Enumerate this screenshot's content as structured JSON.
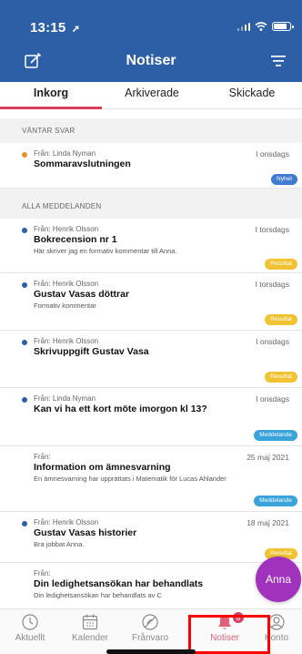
{
  "status": {
    "time": "13:15",
    "location_glyph": "➚"
  },
  "header": {
    "title": "Notiser",
    "color": "#2d5fa6"
  },
  "tabs": [
    {
      "label": "Inkorg",
      "active": true
    },
    {
      "label": "Arkiverade",
      "active": false
    },
    {
      "label": "Skickade",
      "active": false
    }
  ],
  "sections": {
    "waiting": "VÄNTAR SVAR",
    "all": "ALLA MEDDELANDEN"
  },
  "messages": [
    {
      "from": "Från: Linda Nyman",
      "date": "I onsdags",
      "title": "Sommaravslutningen",
      "preview": "",
      "badge": "Nyhet",
      "dot_color": "#e8912c"
    },
    {
      "from": "Från: Henrik Olsson",
      "date": "I torsdags",
      "title": "Bokrecension nr 1",
      "preview": "Här skriver jag en formativ kommentar till Anna.",
      "badge": "Resultat",
      "dot_color": "#2d5fa6"
    },
    {
      "from": "Från: Henrik Olsson",
      "date": "I torsdags",
      "title": "Gustav Vasas döttrar",
      "preview": "Formativ kommentar",
      "badge": "Resultat",
      "dot_color": "#2d5fa6"
    },
    {
      "from": "Från: Henrik Olsson",
      "date": "I onsdags",
      "title": "Skrivuppgift Gustav Vasa",
      "preview": "",
      "badge": "Resultat",
      "dot_color": "#2d5fa6"
    },
    {
      "from": "Från: Linda Nyman",
      "date": "I onsdags",
      "title": "Kan vi ha ett kort möte imorgon kl 13?",
      "preview": "",
      "badge": "Meddelande",
      "dot_color": "#2d5fa6"
    },
    {
      "from": "Från:",
      "date": "25 maj 2021",
      "title": "Information om ämnesvarning",
      "preview": "En ämnesvarning har upprättats i Matematik för Lucas Ahlander",
      "badge": "Meddelande",
      "dot_color": ""
    },
    {
      "from": "Från: Henrik Olsson",
      "date": "18 maj 2021",
      "title": "Gustav Vasas historier",
      "preview": "Bra jobbat Anna.",
      "badge": "Resultat",
      "dot_color": "#2d5fa6"
    },
    {
      "from": "Från:",
      "date": "",
      "title": "Din ledighetsansökan har behandlats",
      "preview": "Din ledighetsansökan har behandlats av C",
      "badge": "",
      "dot_color": ""
    }
  ],
  "badge_colors": {
    "Nyhet": "#3f7bd0",
    "Resultat": "#f1c232",
    "Meddelande": "#3aa3dc"
  },
  "fab": {
    "label": "Anna",
    "color": "#a132be"
  },
  "bottom_nav": [
    {
      "label": "Aktuellt",
      "icon": "clock-icon"
    },
    {
      "label": "Kalender",
      "icon": "calendar-icon"
    },
    {
      "label": "Frånvaro",
      "icon": "absence-icon"
    },
    {
      "label": "Notiser",
      "icon": "bell-icon",
      "active": true,
      "badge": "8"
    },
    {
      "label": "Konto",
      "icon": "account-icon"
    }
  ]
}
